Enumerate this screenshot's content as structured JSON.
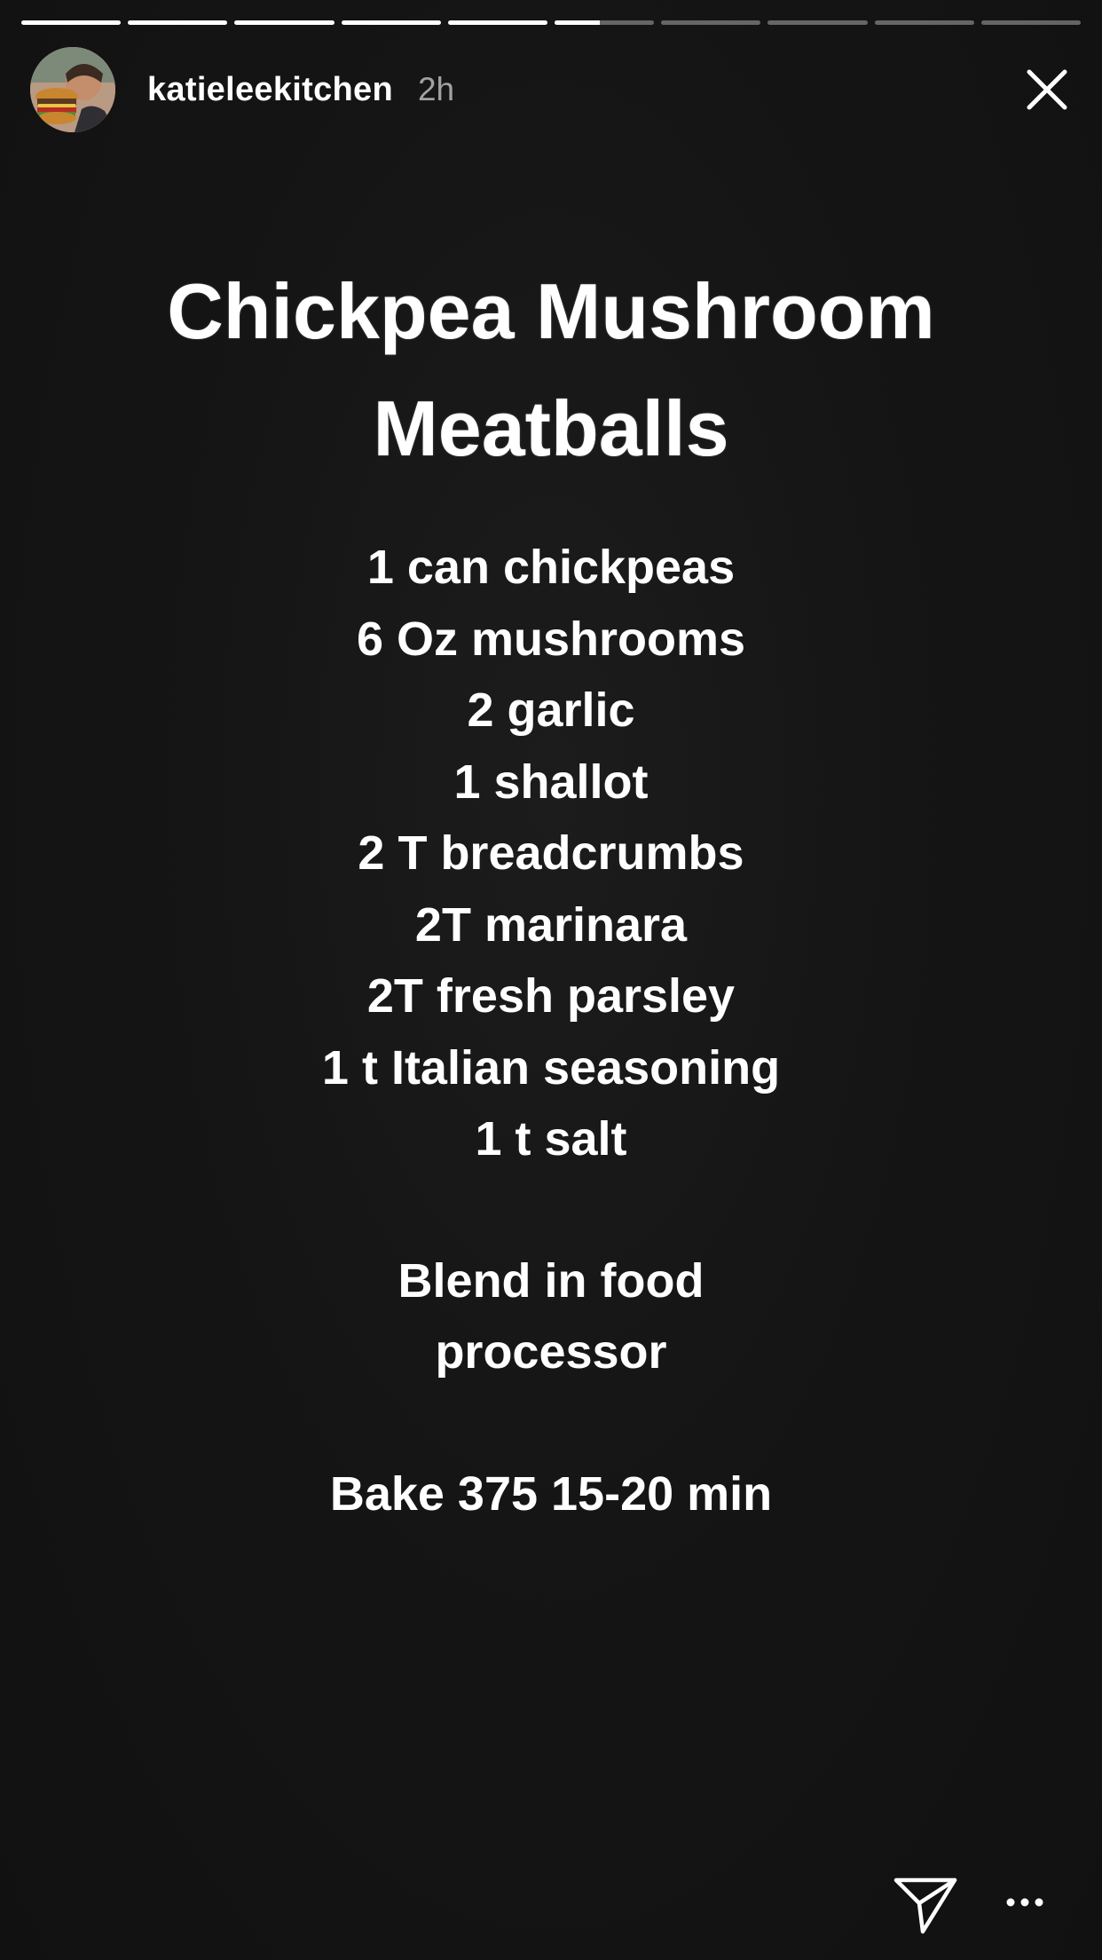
{
  "story": {
    "segments_total": 10,
    "segments_viewed": 5,
    "current_segment_progress": 0.45
  },
  "header": {
    "username": "katieleekitchen",
    "time": "2h",
    "avatar_icon": "profile-photo-icon",
    "close_icon": "close-icon"
  },
  "recipe": {
    "title_line1": "Chickpea Mushroom",
    "title_line2": "Meatballs",
    "ingredients": [
      "1 can chickpeas",
      "6 Oz mushrooms",
      "2 garlic",
      "1 shallot",
      "2 T breadcrumbs",
      "2T marinara",
      "2T fresh parsley",
      "1 t Italian seasoning",
      "1 t salt"
    ],
    "instruction1_line1": "Blend in food",
    "instruction1_line2": "processor",
    "instruction2": "Bake 375 15-20 min"
  },
  "footer": {
    "send_icon": "send-icon",
    "more_icon": "more-icon"
  },
  "colors": {
    "background": "#141414",
    "text": "#ffffff",
    "progress_track": "#5a5a5a",
    "progress_fill": "#ffffff"
  }
}
